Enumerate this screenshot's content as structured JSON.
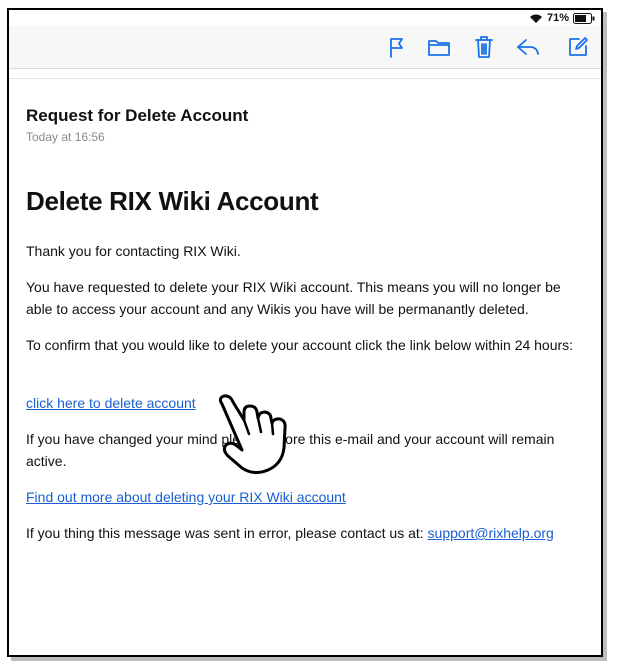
{
  "status": {
    "battery": "71%"
  },
  "toolbar": {
    "icons": [
      "flag-icon",
      "folder-icon",
      "trash-icon",
      "reply-icon",
      "compose-icon"
    ],
    "accent": "#1a73e8"
  },
  "email": {
    "subject": "Request for Delete Account",
    "date": "Today at 16:56",
    "heading": "Delete RIX Wiki Account",
    "p1": "Thank you for contacting RIX Wiki.",
    "p2": "You have requested to delete your RIX Wiki account. This means you will no longer be able to access your account and any Wikis you have will be permanantly deleted.",
    "p3": "To confirm that you would like to delete your account click the link below within 24 hours:",
    "delete_link": "click here to delete account",
    "p4": "If you have changed your mind please ignore this e-mail and your account will remain active.",
    "info_link": "Find out more about deleting your RIX Wiki account",
    "p5": "If you thing this message was sent in error, please contact us at: ",
    "support_email": "support@rixhelp.org"
  },
  "colors": {
    "link": "#1a5fd1",
    "date": "#8a8a8a"
  }
}
